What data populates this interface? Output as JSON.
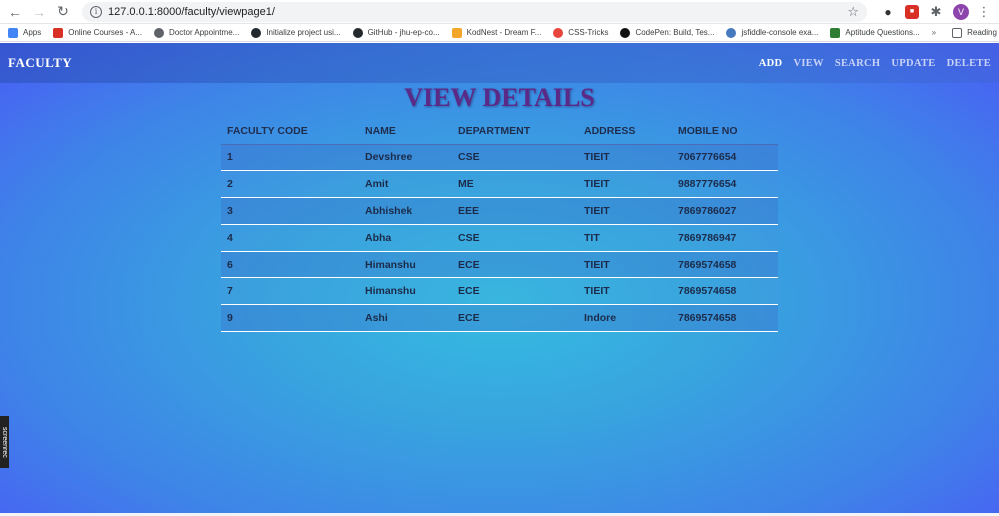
{
  "browser": {
    "url": "127.0.0.1:8000/faculty/viewpage1/",
    "avatar_letter": "V",
    "bookmarks": [
      {
        "label": "Apps",
        "icon": "apps-grid-icon",
        "color": "#4285f4"
      },
      {
        "label": "Online Courses - A...",
        "icon": "coursera-icon",
        "color": "#d93025"
      },
      {
        "label": "Doctor Appointme...",
        "icon": "globe-icon",
        "color": "#5f6368"
      },
      {
        "label": "Initialize project usi...",
        "icon": "github-icon",
        "color": "#24292e"
      },
      {
        "label": "GitHub - jhu-ep-co...",
        "icon": "github-icon",
        "color": "#24292e"
      },
      {
        "label": "KodNest - Dream F...",
        "icon": "kodnest-icon",
        "color": "#f4a62a"
      },
      {
        "label": "CSS-Tricks",
        "icon": "css-tricks-icon",
        "color": "#e8453c"
      },
      {
        "label": "CodePen: Build, Tes...",
        "icon": "codepen-icon",
        "color": "#111111"
      },
      {
        "label": "jsfiddle-console exa...",
        "icon": "jsfiddle-icon",
        "color": "#4679bd"
      },
      {
        "label": "Aptitude Questions...",
        "icon": "aptitude-icon",
        "color": "#2e7d32"
      }
    ],
    "bookmarks_more": "»",
    "reading_list": "Reading list"
  },
  "navbar": {
    "brand": "FACULTY",
    "links": [
      "ADD",
      "VIEW",
      "SEARCH",
      "UPDATE",
      "DELETE"
    ]
  },
  "page": {
    "title": "VIEW DETAILS"
  },
  "table": {
    "headers": [
      "FACULTY CODE",
      "NAME",
      "DEPARTMENT",
      "ADDRESS",
      "MOBILE NO"
    ],
    "rows": [
      [
        "1",
        "Devshree",
        "CSE",
        "TIEIT",
        "7067776654"
      ],
      [
        "2",
        "Amit",
        "ME",
        "TIEIT",
        "9887776654"
      ],
      [
        "3",
        "Abhishek",
        "EEE",
        "TIEIT",
        "7869786027"
      ],
      [
        "4",
        "Abha",
        "CSE",
        "TIT",
        "7869786947"
      ],
      [
        "6",
        "Himanshu",
        "ECE",
        "TIEIT",
        "7869574658"
      ],
      [
        "7",
        "Himanshu",
        "ECE",
        "TIEIT",
        "7869574658"
      ],
      [
        "9",
        "Ashi",
        "ECE",
        "Indore",
        "7869574658"
      ]
    ]
  },
  "overlay": {
    "screenrec": "screenrec"
  }
}
